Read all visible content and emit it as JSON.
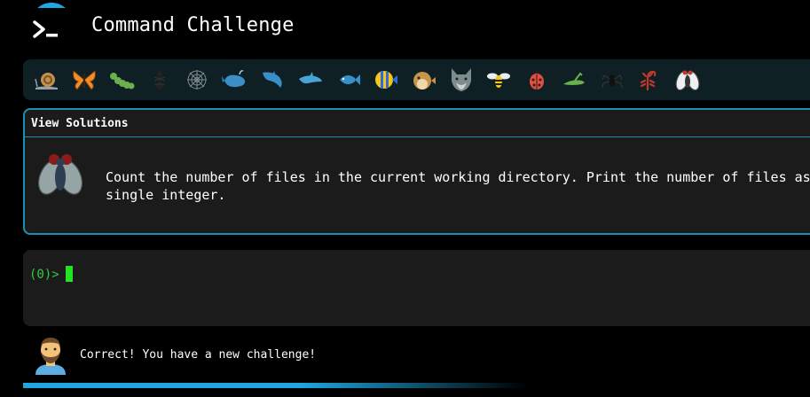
{
  "app": {
    "title": "Command Challenge"
  },
  "animals": [
    {
      "name": "snail"
    },
    {
      "name": "butterfly"
    },
    {
      "name": "caterpillar"
    },
    {
      "name": "ant"
    },
    {
      "name": "spiderweb"
    },
    {
      "name": "whale"
    },
    {
      "name": "dolphin-spouting"
    },
    {
      "name": "dolphin"
    },
    {
      "name": "fish"
    },
    {
      "name": "tropical-fish"
    },
    {
      "name": "blowfish"
    },
    {
      "name": "wolf"
    },
    {
      "name": "bee"
    },
    {
      "name": "ladybug"
    },
    {
      "name": "cricket"
    },
    {
      "name": "spider"
    },
    {
      "name": "scorpion"
    },
    {
      "name": "fly"
    }
  ],
  "challenge": {
    "view_solutions": "View Solutions",
    "description": "Count the number of files in the current working directory. Print the number of files as a\nsingle integer."
  },
  "terminal": {
    "prompt": "(0)>"
  },
  "status": {
    "message": "Correct! You have a new challenge!"
  },
  "progress": {
    "fraction": 0.64
  },
  "colors": {
    "accent": "#1ea7e0",
    "prompt": "#2ecc40",
    "cursor": "#22e322"
  }
}
